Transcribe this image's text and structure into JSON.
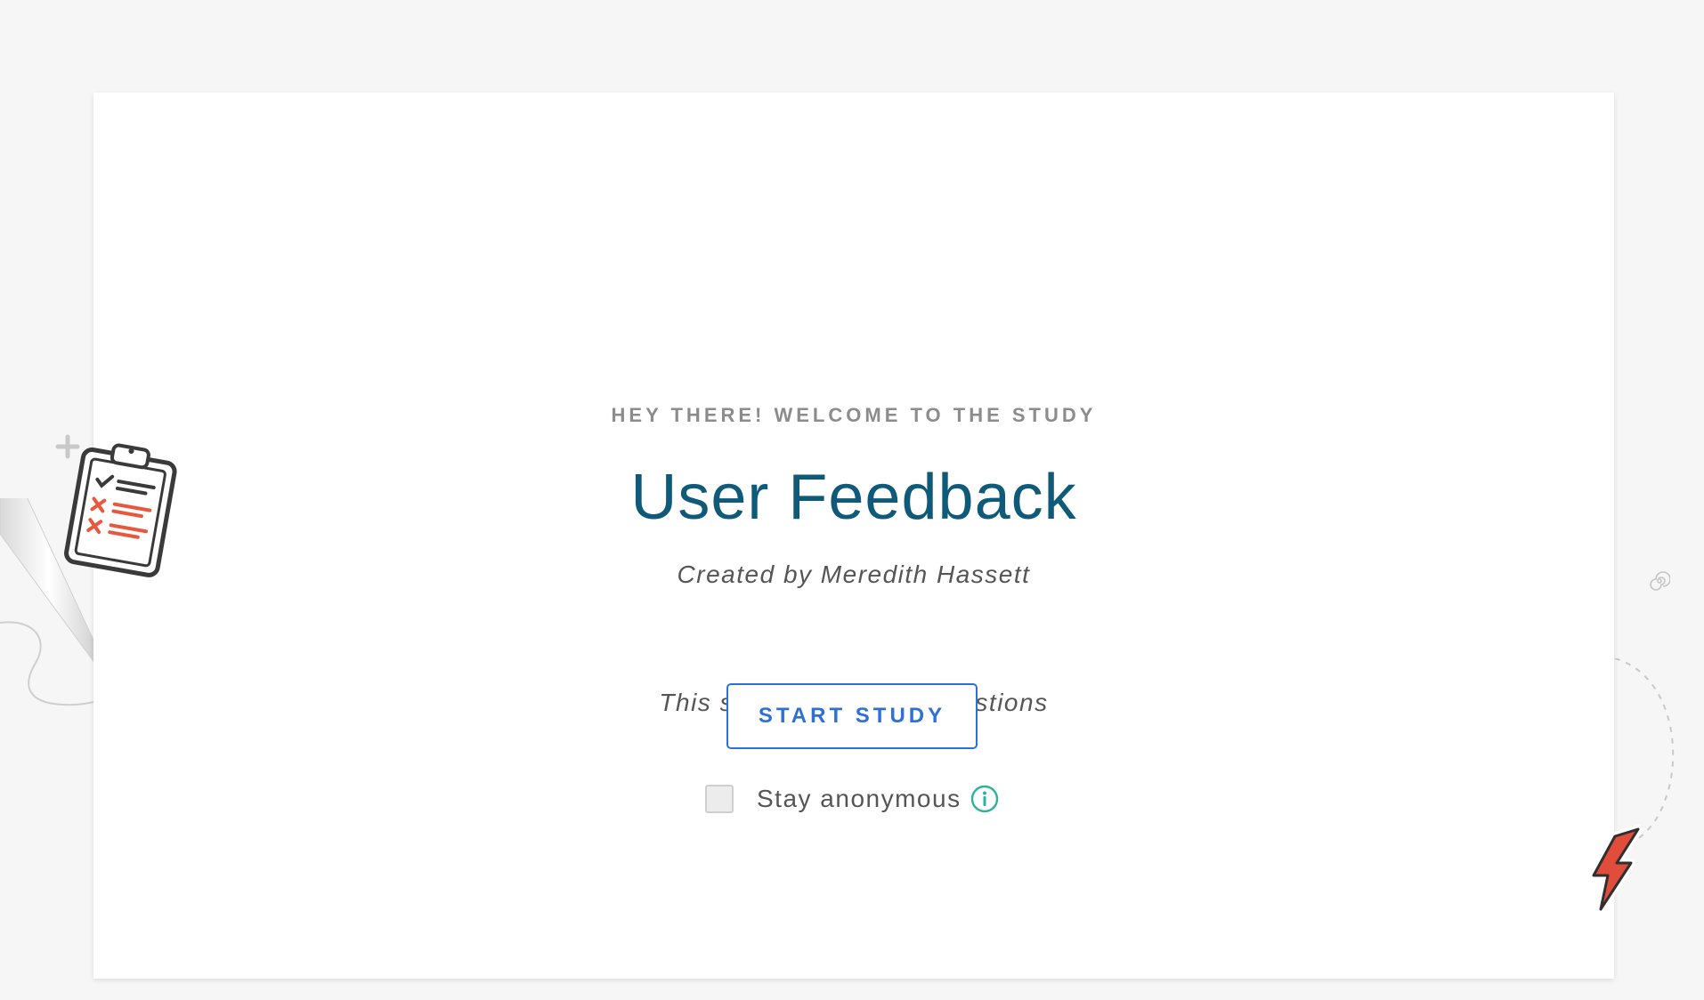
{
  "welcome": {
    "eyebrow": "HEY THERE! WELCOME TO THE STUDY",
    "title": "User Feedback",
    "author": "Created by Meredith Hassett",
    "question_count": "This study contains 2 questions"
  },
  "actions": {
    "start_label": "START STUDY",
    "anonymous_label": "Stay anonymous",
    "anonymous_checked": false
  },
  "icons": {
    "info": "info-icon",
    "clipboard": "clipboard-icon",
    "lightning": "lightning-bolt-icon",
    "plus": "plus-icon",
    "spiral": "spiral-icon"
  },
  "colors": {
    "title": "#0e5a78",
    "eyebrow": "#8c8c8c",
    "button": "#2f6fd8",
    "info": "#2bb3a0",
    "bolt": "#e24c3a",
    "background": "#f6f6f6"
  }
}
